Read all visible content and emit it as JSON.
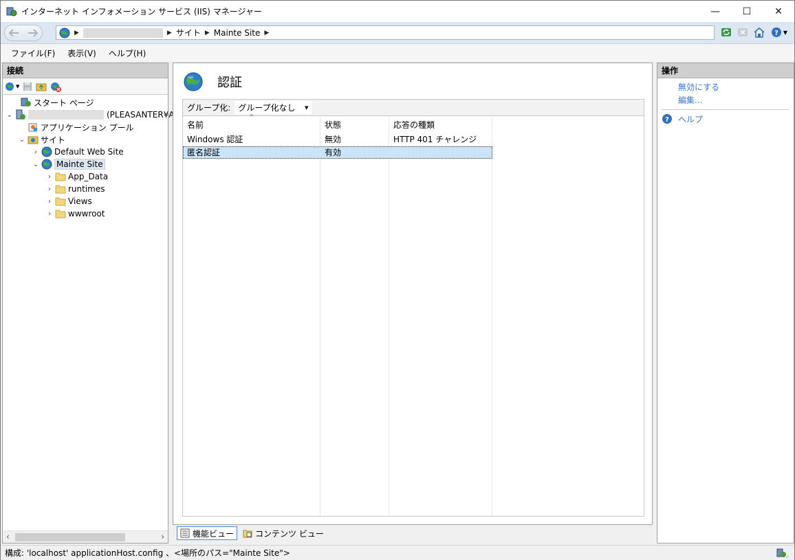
{
  "window": {
    "title": "インターネット インフォメーション サービス (IIS) マネージャー",
    "minimize": "—",
    "maximize": "☐",
    "close": "✕"
  },
  "address": {
    "crumbs": [
      "サイト",
      "Mainte Site"
    ]
  },
  "menu": [
    "ファイル(F)",
    "表示(V)",
    "ヘルプ(H)"
  ],
  "connections": {
    "header": "接続",
    "tree": [
      {
        "label": "スタート ページ",
        "icon": "start-page-icon"
      },
      {
        "label": "(PLEASANTER¥A",
        "icon": "server-icon"
      },
      {
        "label": "アプリケーション プール",
        "icon": "app-pool-icon"
      },
      {
        "label": "サイト",
        "icon": "sites-folder-icon"
      },
      {
        "label": "Default Web Site",
        "icon": "globe-icon"
      },
      {
        "label": "Mainte Site",
        "icon": "globe-icon"
      },
      {
        "label": "App_Data",
        "icon": "folder-icon"
      },
      {
        "label": "runtimes",
        "icon": "folder-icon"
      },
      {
        "label": "Views",
        "icon": "folder-icon"
      },
      {
        "label": "wwwroot",
        "icon": "folder-icon"
      }
    ]
  },
  "feature": {
    "title": "認証",
    "group_label": "グループ化:",
    "group_value": "グループ化なし",
    "columns": [
      "名前",
      "状態",
      "応答の種類"
    ],
    "rows": [
      {
        "name": "Windows 認証",
        "status": "無効",
        "type": "HTTP 401 チャレンジ",
        "selected": false
      },
      {
        "name": "匿名認証",
        "status": "有効",
        "type": "",
        "selected": true
      }
    ]
  },
  "view_tabs": {
    "features": "機能ビュー",
    "content": "コンテンツ ビュー"
  },
  "actions": {
    "header": "操作",
    "items": [
      "無効にする",
      "編集..."
    ],
    "help": "ヘルプ"
  },
  "status": {
    "text": "構成: 'localhost' applicationHost.config 、<場所のパス=\"Mainte Site\">"
  },
  "colors": {
    "accent": "#3c78c3",
    "selection": "#cce4f7",
    "panel_header": "#cfcfcf"
  }
}
